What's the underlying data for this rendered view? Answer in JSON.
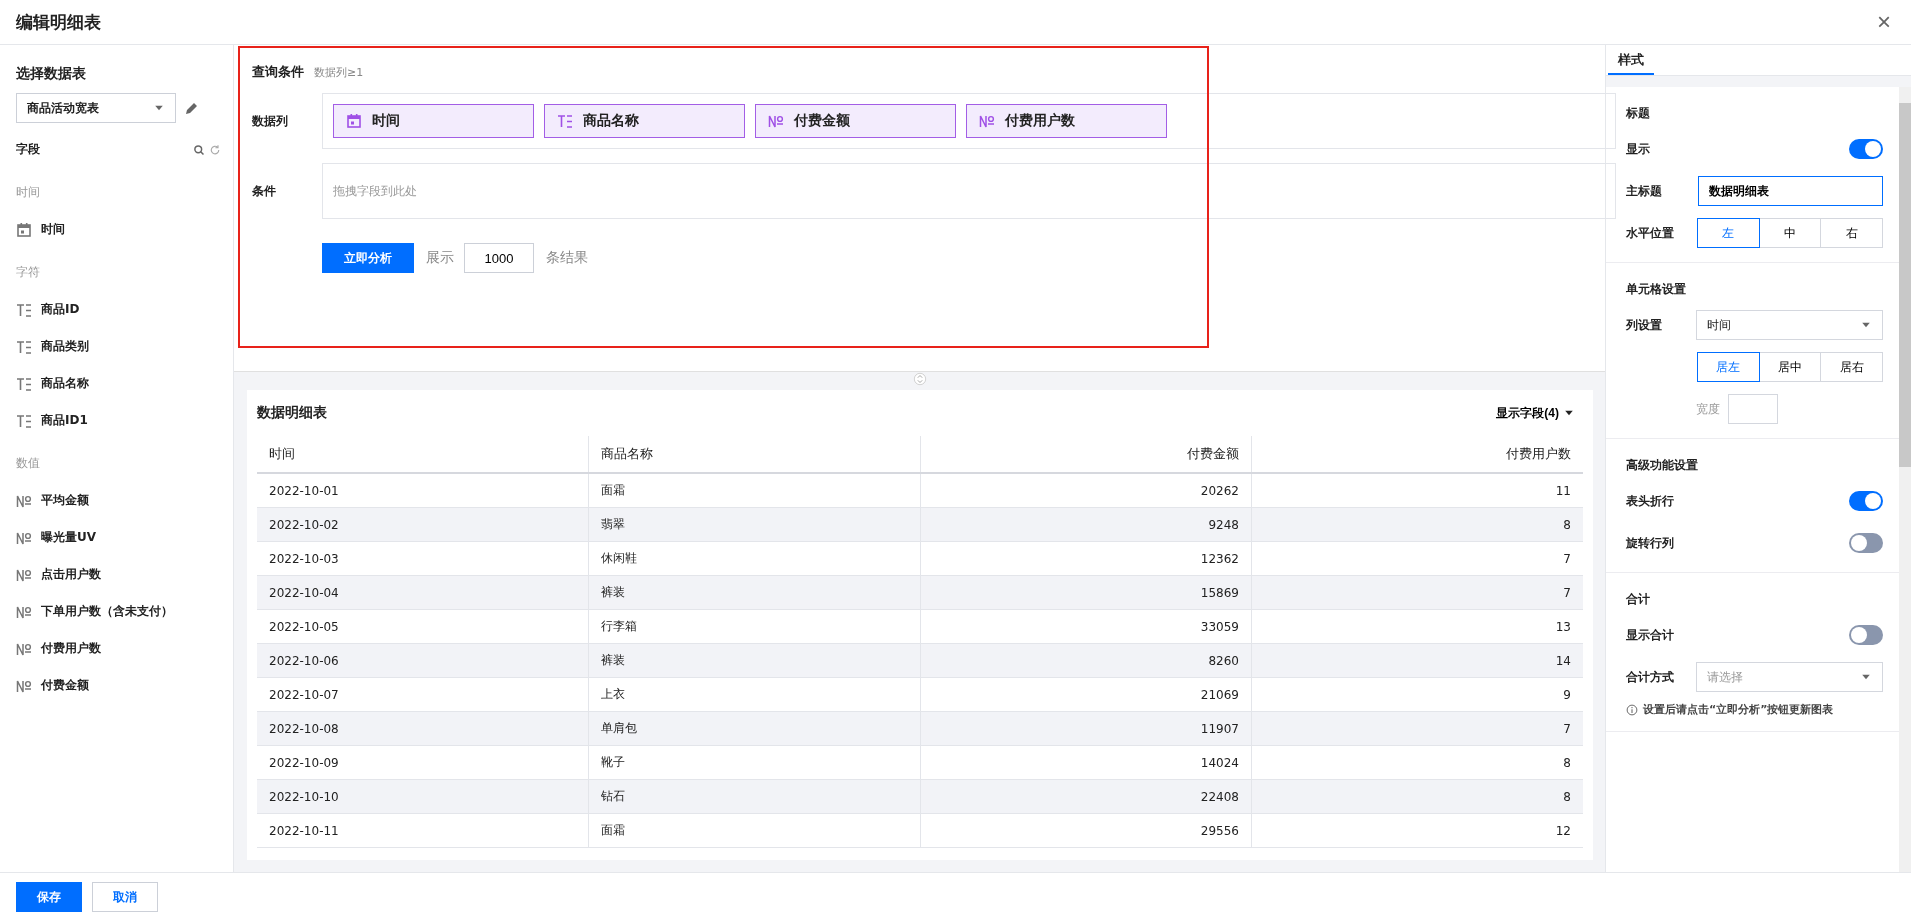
{
  "window": {
    "title": "编辑明细表",
    "close": "×"
  },
  "sidebar": {
    "heading": "选择数据表",
    "table_select": {
      "value": "商品活动宽表"
    },
    "fields_heading": "字段",
    "groups": [
      {
        "label": "时间",
        "items": [
          {
            "kind": "date",
            "label": "时间"
          }
        ]
      },
      {
        "label": "字符",
        "items": [
          {
            "kind": "text",
            "label": "商品ID"
          },
          {
            "kind": "text",
            "label": "商品类别"
          },
          {
            "kind": "text",
            "label": "商品名称"
          },
          {
            "kind": "text",
            "label": "商品ID1"
          }
        ]
      },
      {
        "label": "数值",
        "items": [
          {
            "kind": "number",
            "label": "平均金额"
          },
          {
            "kind": "number",
            "label": "曝光量UV"
          },
          {
            "kind": "number",
            "label": "点击用户数"
          },
          {
            "kind": "number",
            "label": "下单用户数（含未支付）"
          },
          {
            "kind": "number",
            "label": "付费用户数"
          },
          {
            "kind": "number",
            "label": "付费金额"
          }
        ]
      }
    ]
  },
  "query": {
    "title": "查询条件",
    "hint": "数据列≥1",
    "highlighted": true,
    "columns_label": "数据列",
    "columns": [
      {
        "kind": "date",
        "label": "时间"
      },
      {
        "kind": "text",
        "label": "商品名称"
      },
      {
        "kind": "number",
        "label": "付费金额"
      },
      {
        "kind": "number",
        "label": "付费用户数"
      }
    ],
    "conditions_label": "条件",
    "conditions_placeholder": "拖拽字段到此处",
    "analyze_button": "立即分析",
    "show_label": "展示",
    "show_count": "1000",
    "show_suffix": "条结果"
  },
  "table": {
    "title": "数据明细表",
    "fields_button": "显示字段(4)",
    "columns": [
      {
        "label": "时间",
        "kind": "text"
      },
      {
        "label": "商品名称",
        "kind": "text"
      },
      {
        "label": "付费金额",
        "kind": "number"
      },
      {
        "label": "付费用户数",
        "kind": "number"
      }
    ],
    "rows": [
      [
        "2022-10-01",
        "面霜",
        "20262",
        "11"
      ],
      [
        "2022-10-02",
        "翡翠",
        "9248",
        "8"
      ],
      [
        "2022-10-03",
        "休闲鞋",
        "12362",
        "7"
      ],
      [
        "2022-10-04",
        "裤装",
        "15869",
        "7"
      ],
      [
        "2022-10-05",
        "行李箱",
        "33059",
        "13"
      ],
      [
        "2022-10-06",
        "裤装",
        "8260",
        "14"
      ],
      [
        "2022-10-07",
        "上衣",
        "21069",
        "9"
      ],
      [
        "2022-10-08",
        "单肩包",
        "11907",
        "7"
      ],
      [
        "2022-10-09",
        "靴子",
        "14024",
        "8"
      ],
      [
        "2022-10-10",
        "钻石",
        "22408",
        "8"
      ],
      [
        "2022-10-11",
        "面霜",
        "29556",
        "12"
      ]
    ]
  },
  "style_panel": {
    "tab": {
      "label": "样式",
      "selected": true
    },
    "title_section": {
      "heading": "标题",
      "show_label": "显示",
      "show_on": true,
      "main_title_label": "主标题",
      "main_title_value": "数据明细表",
      "position_label": "水平位置",
      "positions": [
        {
          "label": "左",
          "selected": true
        },
        {
          "label": "中",
          "selected": false
        },
        {
          "label": "右",
          "selected": false
        }
      ]
    },
    "cell_section": {
      "heading": "单元格设置",
      "column_label": "列设置",
      "column_value": "时间",
      "aligns": [
        {
          "label": "居左",
          "selected": true
        },
        {
          "label": "居中",
          "selected": false
        },
        {
          "label": "居右",
          "selected": false
        }
      ],
      "width_label": "宽度"
    },
    "advanced_section": {
      "heading": "高级功能设置",
      "toggles": [
        {
          "label": "表头折行",
          "on": true
        },
        {
          "label": "旋转行列",
          "on": false
        }
      ]
    },
    "total_section": {
      "heading": "合计",
      "toggles": [
        {
          "label": "显示合计",
          "on": false
        }
      ],
      "method_label": "合计方式",
      "method_placeholder": "请选择",
      "note": "设置后请点击“立即分析”按钮更新图表"
    }
  },
  "footer": {
    "save": "保存",
    "cancel": "取消"
  }
}
